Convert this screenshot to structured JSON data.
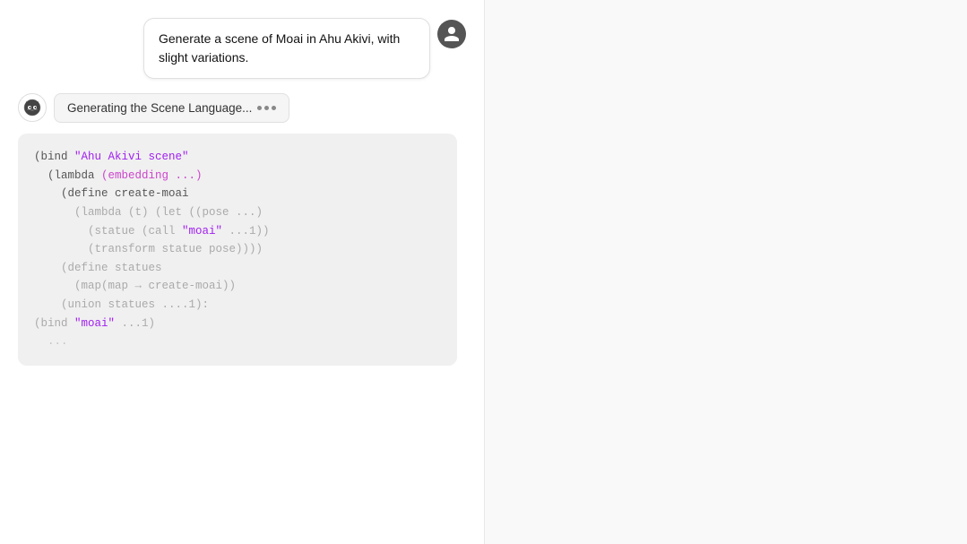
{
  "chat": {
    "user_message": "Generate a scene of Moai in Ahu Akivi, with slight variations.",
    "bot_status": "Generating the Scene Language...",
    "code_lines": [
      {
        "text": "(bind ",
        "parts": [
          {
            "text": "(bind ",
            "class": "c-default"
          },
          {
            "text": "\"Ahu Akivi scene\"",
            "class": "c-string"
          }
        ]
      },
      {
        "text": "  (lambda (embedding ...)",
        "parts": [
          {
            "text": "  (lambda ",
            "class": "c-default"
          },
          {
            "text": "(embedding ...)",
            "class": "c-special"
          }
        ]
      },
      {
        "text": "    (define create-moai",
        "parts": [
          {
            "text": "    (define create-moai",
            "class": "c-default"
          }
        ]
      },
      {
        "text": "      (lambda (t) (let ((pose ...)",
        "parts": [
          {
            "text": "      ",
            "class": "c-default"
          },
          {
            "text": "(lambda (t) (let ((pose ...)",
            "class": "c-faded"
          }
        ]
      },
      {
        "text": "        (statue (call \"moai\" ...1))",
        "parts": [
          {
            "text": "        ",
            "class": "c-default"
          },
          {
            "text": "(statue (call ",
            "class": "c-faded"
          },
          {
            "text": "\"moai\"",
            "class": "c-string"
          },
          {
            "text": " ...1))",
            "class": "c-faded"
          }
        ]
      },
      {
        "text": "        (transform statue pose))))",
        "parts": [
          {
            "text": "        ",
            "class": "c-default"
          },
          {
            "text": "(transform statue pose))))",
            "class": "c-faded"
          }
        ]
      },
      {
        "text": "    (define statues",
        "parts": [
          {
            "text": "    ",
            "class": "c-default"
          },
          {
            "text": "(define statues",
            "class": "c-faded"
          }
        ]
      },
      {
        "text": "      (map(map → create-moai))",
        "parts": [
          {
            "text": "      ",
            "class": "c-default"
          },
          {
            "text": "(map(map → create-moai))",
            "class": "c-faded"
          }
        ]
      },
      {
        "text": "    (union statues ....1):",
        "parts": [
          {
            "text": "    ",
            "class": "c-default"
          },
          {
            "text": "(union statues ....1):",
            "class": "c-faded"
          }
        ]
      },
      {
        "text": "(bind \"moai\" ...1)",
        "parts": [
          {
            "text": "(bind ",
            "class": "c-faded"
          },
          {
            "text": "\"moai\"",
            "class": "c-string"
          },
          {
            "text": " ...1)",
            "class": "c-faded"
          }
        ]
      },
      {
        "text": "  ...",
        "parts": [
          {
            "text": "  ...",
            "class": "c-faded"
          }
        ]
      }
    ]
  },
  "icons": {
    "user_avatar": "person-icon",
    "bot_avatar": "robot-icon"
  }
}
